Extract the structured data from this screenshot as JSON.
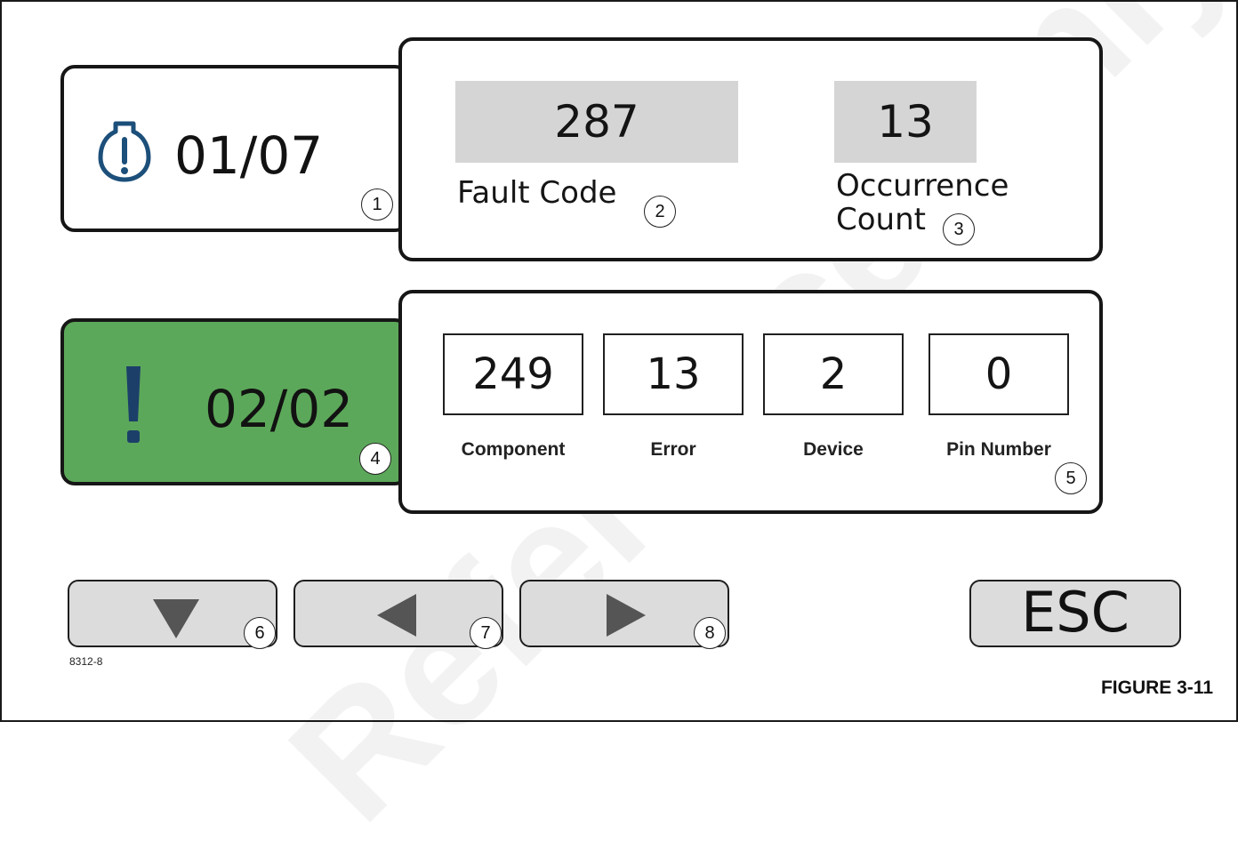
{
  "fault_1": {
    "index": "01/07",
    "icon": "engine-warning-icon",
    "fault_code_value": "287",
    "fault_code_label": "Fault Code",
    "occurrence_value": "13",
    "occurrence_label_line1": "Occurrence",
    "occurrence_label_line2": "Count"
  },
  "fault_2": {
    "index": "02/02",
    "icon": "exclamation-icon",
    "highlight_color": "#5ca85a",
    "fields": [
      {
        "value": "249",
        "label": "Component"
      },
      {
        "value": "13",
        "label": "Error"
      },
      {
        "value": "2",
        "label": "Device"
      },
      {
        "value": "0",
        "label": "Pin Number"
      }
    ]
  },
  "buttons": {
    "down_icon": "triangle-down-icon",
    "left_icon": "triangle-left-icon",
    "right_icon": "triangle-right-icon",
    "esc_label": "ESC"
  },
  "callouts": [
    "1",
    "2",
    "3",
    "4",
    "5",
    "6",
    "7",
    "8"
  ],
  "image_code": "8312-8",
  "figure_label": "FIGURE 3-11",
  "watermark": "Reference Only"
}
